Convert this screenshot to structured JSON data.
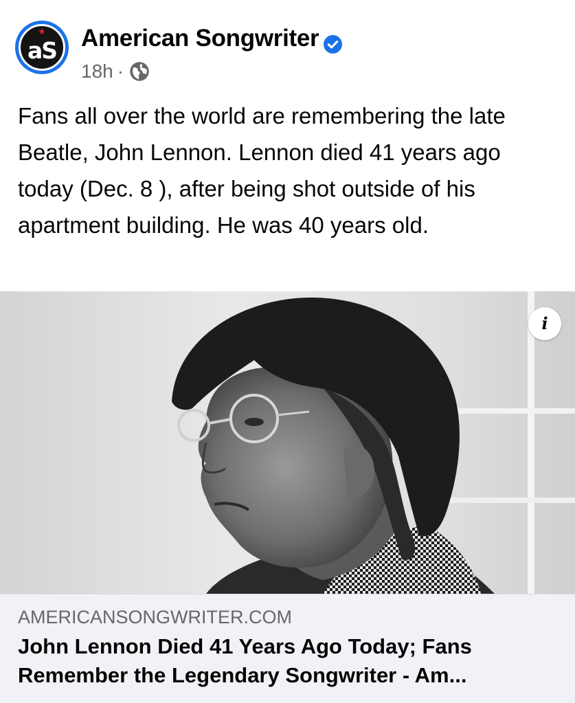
{
  "post": {
    "author": {
      "name": "American Songwriter",
      "avatar_text": "aS",
      "verified": true
    },
    "timestamp": "18h",
    "separator": "·",
    "audience_icon": "globe-icon",
    "message": "Fans all over the world are remembering the late Beatle, John Lennon. Lennon died 41 years ago today (Dec. 8 ), after being shot outside of his apartment building. He was 40 years old.",
    "link": {
      "domain": "AMERICANSONGWRITER.COM",
      "title": "John Lennon Died 41 Years Ago Today; Fans Remember the Legendary Songwriter - Am...",
      "info_icon": "i"
    }
  },
  "colors": {
    "verified_blue": "#1b72e8",
    "meta_gray": "#65676b",
    "link_meta_bg": "#f0f2f5",
    "avatar_star": "#e02424"
  }
}
